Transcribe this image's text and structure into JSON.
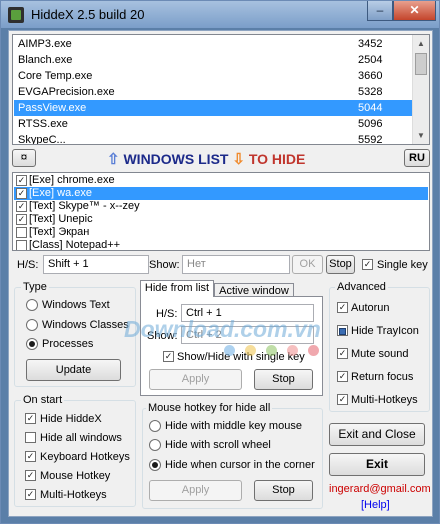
{
  "window": {
    "title": "HiddeX 2.5 build 20",
    "minimize": "–",
    "close": "✕"
  },
  "processes": [
    {
      "name": "AIMP3.exe",
      "pid": "3452"
    },
    {
      "name": "Blanch.exe",
      "pid": "2504"
    },
    {
      "name": "Core Temp.exe",
      "pid": "3660"
    },
    {
      "name": "EVGAPrecision.exe",
      "pid": "5328"
    },
    {
      "name": "PassView.exe",
      "pid": "5044",
      "selected": true
    },
    {
      "name": "RTSS.exe",
      "pid": "5096"
    },
    {
      "name": "SkypeC...",
      "pid": "5592"
    }
  ],
  "banner": {
    "left_button": "¤",
    "windows_list": "WINDOWS LIST",
    "to_hide": "TO HIDE",
    "lang_button": "RU",
    "arrow_up": "⇧",
    "arrow_down": "⇩"
  },
  "hide_list": [
    {
      "label": "[Exe] chrome.exe",
      "checked": true
    },
    {
      "label": "[Exe] wa.exe",
      "checked": true,
      "selected": true
    },
    {
      "label": "[Text] Skype™ - x--zey",
      "checked": true
    },
    {
      "label": "[Text] Unepic",
      "checked": true
    },
    {
      "label": "[Text] Экран",
      "checked": false
    },
    {
      "label": "[Class] Notepad++",
      "checked": false
    }
  ],
  "hs_bar": {
    "hs_label": "H/S:",
    "hs_value": "Shift + 1",
    "show_label": "Show:",
    "show_value": "Нет",
    "ok": "OK",
    "stop": "Stop",
    "single_key": "Single key",
    "single_key_checked": true
  },
  "type_group": {
    "title": "Type",
    "options": [
      "Windows Text",
      "Windows Classes",
      "Processes"
    ],
    "selected": "Processes",
    "update": "Update"
  },
  "hide_tabs": {
    "tab1": "Hide from list",
    "tab2": "Active window",
    "hs_label": "H/S:",
    "hs_value": "Ctrl + 1",
    "show_label": "Show:",
    "show_value": "Ctrl + 2",
    "single_key": "Show/Hide with single key",
    "apply": "Apply",
    "stop": "Stop"
  },
  "advanced": {
    "title": "Advanced",
    "items": [
      {
        "label": "Autorun",
        "checked": true
      },
      {
        "label": "Hide TrayIcon",
        "checked": false
      },
      {
        "label": "Mute sound",
        "checked": true
      },
      {
        "label": "Return focus",
        "checked": true
      },
      {
        "label": "Multi-Hotkeys",
        "checked": true
      }
    ]
  },
  "on_start": {
    "title": "On start",
    "items": [
      {
        "label": "Hide HiddeX",
        "checked": true
      },
      {
        "label": "Hide all windows",
        "checked": false
      },
      {
        "label": "Keyboard Hotkeys",
        "checked": true
      },
      {
        "label": "Mouse Hotkey",
        "checked": true
      },
      {
        "label": "Multi-Hotkeys",
        "checked": true
      }
    ]
  },
  "mouse_hotkey": {
    "title": "Mouse hotkey for hide all",
    "options": [
      "Hide with middle key mouse",
      "Hide with scroll wheel",
      "Hide when cursor in the corner"
    ],
    "selected": "Hide when cursor in the corner",
    "apply": "Apply",
    "stop": "Stop"
  },
  "actions": {
    "exit_close": "Exit and Close",
    "exit": "Exit"
  },
  "footer": {
    "email": "ingerard@gmail.com",
    "help": "[Help]"
  },
  "watermark": "Download.com.vn",
  "colors": {
    "selection": "#3399ff",
    "window_frame": "#5b7fa8",
    "banner_blue": "#1c2a8a",
    "banner_red": "#c0352d",
    "email": "#cc0000"
  }
}
